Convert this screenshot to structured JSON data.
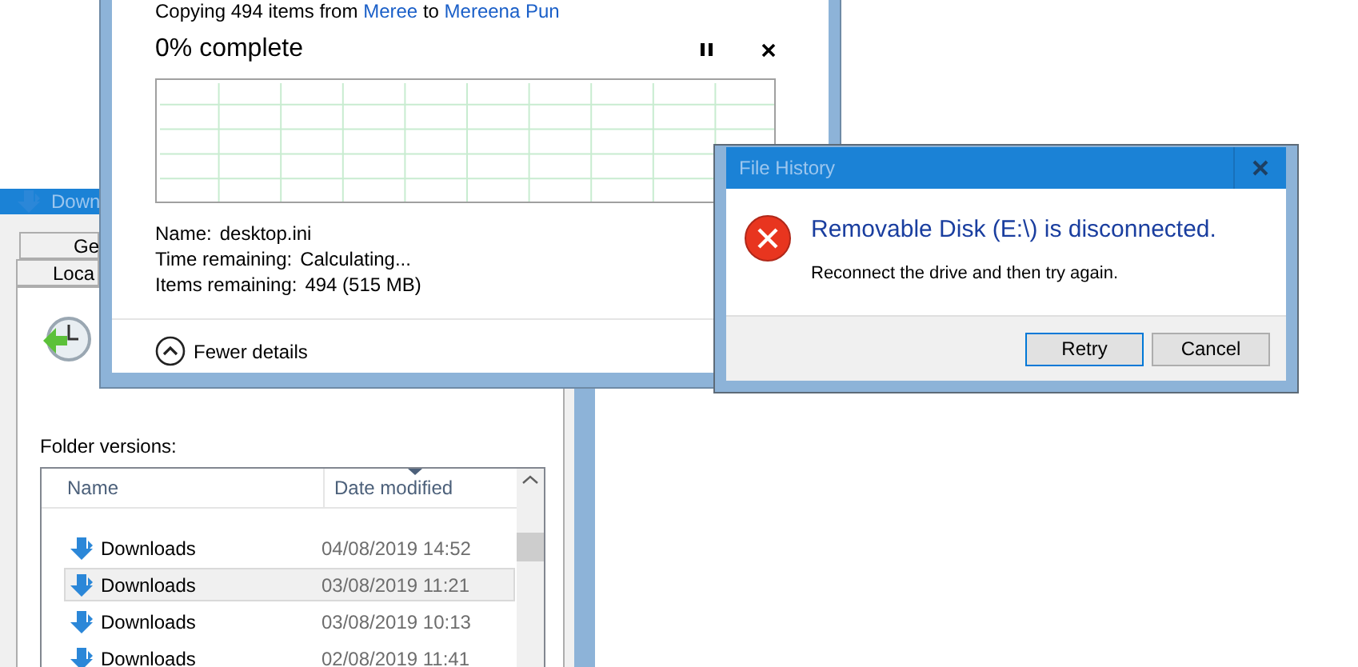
{
  "properties_window": {
    "title": "Down",
    "tabs": [
      {
        "label": "Ge",
        "selected": false
      },
      {
        "label": "Loca",
        "selected": false
      }
    ],
    "folder_versions_label": "Folder versions:",
    "columns": [
      "Name",
      "Date modified"
    ],
    "rows": [
      {
        "name": "Downloads",
        "date": "04/08/2019 14:52",
        "selected": false
      },
      {
        "name": "Downloads",
        "date": "03/08/2019 11:21",
        "selected": true
      },
      {
        "name": "Downloads",
        "date": "03/08/2019 10:13",
        "selected": false
      },
      {
        "name": "Downloads",
        "date": "02/08/2019 11:41",
        "selected": false
      }
    ]
  },
  "copy_dialog": {
    "header": [
      {
        "text": "Copying 494 items from",
        "kind": "plain"
      },
      {
        "text": "Meree",
        "kind": "link"
      },
      {
        "text": "to",
        "kind": "plain"
      },
      {
        "text": "Mereena Pun",
        "kind": "link"
      }
    ],
    "progress_text": "0% complete",
    "details": [
      {
        "label": "Name:",
        "value": "desktop.ini"
      },
      {
        "label": "Time remaining:",
        "value": "Calculating..."
      },
      {
        "label": "Items remaining:",
        "value": "494 (515 MB)"
      }
    ],
    "toggle": {
      "label": "Fewer details",
      "expanded": true
    }
  },
  "error_dialog": {
    "title": "File History",
    "heading": "Removable Disk (E:\\) is disconnected.",
    "message": "Reconnect the drive and then try again.",
    "buttons": [
      {
        "label": "Retry",
        "default": true
      },
      {
        "label": "Cancel",
        "default": false
      }
    ]
  }
}
